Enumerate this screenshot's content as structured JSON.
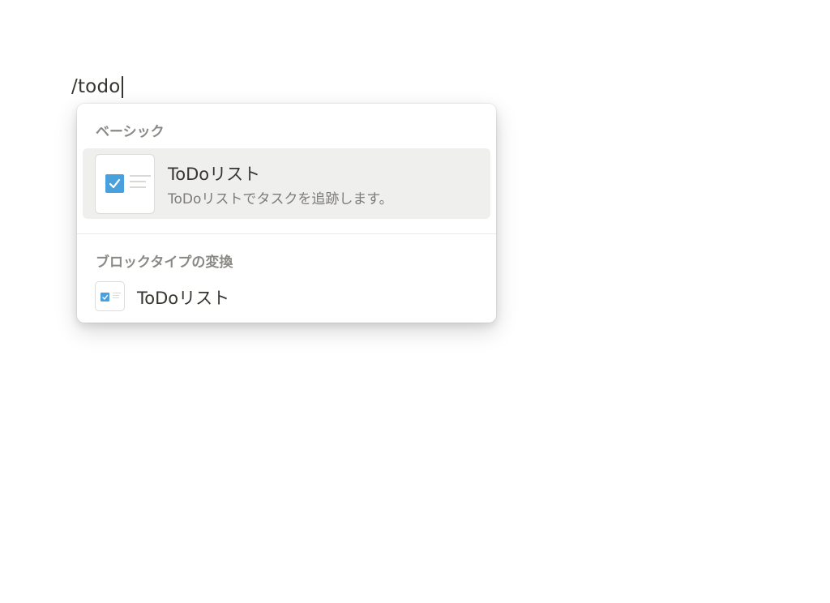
{
  "editor": {
    "text": "/todo"
  },
  "menu": {
    "section_basic": "ベーシック",
    "section_convert": "ブロックタイプの変換",
    "selected_item": {
      "title": "ToDoリスト",
      "description": "ToDoリストでタスクを追跡します。",
      "icon": "todo-checkbox-icon"
    },
    "convert_item": {
      "title": "ToDoリスト",
      "icon": "todo-checkbox-icon"
    }
  },
  "colors": {
    "checkbox": "#4aa0dc",
    "selected_bg": "#efefee",
    "section_label": "#8a8985",
    "text": "#37352f"
  }
}
